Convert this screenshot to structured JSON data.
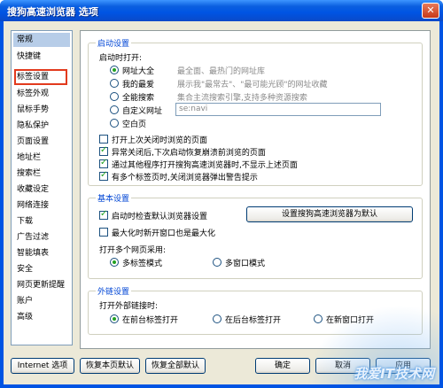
{
  "window": {
    "title": "搜狗高速浏览器 选项",
    "close_label": "✕"
  },
  "sidebar": {
    "items": [
      {
        "label": "常规"
      },
      {
        "label": "快捷键"
      },
      {
        "label": "标签设置"
      },
      {
        "label": "标签外观"
      },
      {
        "label": "鼠标手势"
      },
      {
        "label": "隐私保护"
      },
      {
        "label": "页面设置"
      },
      {
        "label": "地址栏"
      },
      {
        "label": "搜索栏"
      },
      {
        "label": "收藏设定"
      },
      {
        "label": "网络连接"
      },
      {
        "label": "下载"
      },
      {
        "label": "广告过滤"
      },
      {
        "label": "智能填表"
      },
      {
        "label": "安全"
      },
      {
        "label": "网页更新提醒"
      },
      {
        "label": "账户"
      },
      {
        "label": "高级"
      }
    ]
  },
  "startup": {
    "group_title": "启动设置",
    "open_label": "启动时打开:",
    "options": [
      {
        "label": "网址大全",
        "desc": "最全面、最热门的网址库",
        "checked": true
      },
      {
        "label": "我的最爱",
        "desc": "展示我\"最常去\"、\"最可能光顾\"的网址收藏",
        "checked": false
      },
      {
        "label": "全能搜索",
        "desc": "集合主流搜索引擎,支持多种资源搜索",
        "checked": false
      },
      {
        "label": "自定义网址",
        "desc": "",
        "checked": false
      },
      {
        "label": "空白页",
        "desc": "",
        "checked": false
      }
    ],
    "custom_url_value": "se:navi",
    "checkboxes": [
      {
        "label": "打开上次关闭时浏览的页面",
        "checked": false
      },
      {
        "label": "异常关闭后,下次启动恢复崩溃前浏览的页面",
        "checked": true
      },
      {
        "label": "通过其他程序打开搜狗高速浏览器时,不显示上述页面",
        "checked": true
      },
      {
        "label": "有多个标签页时,关闭浏览器弹出警告提示",
        "checked": true
      }
    ]
  },
  "basic": {
    "group_title": "基本设置",
    "check_default_label": "启动时检查默认浏览器设置",
    "check_default_checked": true,
    "set_default_button": "设置搜狗高速浏览器为默认",
    "maximize_label": "最大化时新开窗口也是最大化",
    "maximize_checked": false,
    "multi_open_label": "打开多个网页采用:",
    "multi_tab_label": "多标签模式",
    "multi_window_label": "多窗口模式"
  },
  "external": {
    "group_title": "外链设置",
    "open_label": "打开外部链接时:",
    "front_tab_label": "在前台标签打开",
    "back_tab_label": "在后台标签打开",
    "new_window_label": "在新窗口打开"
  },
  "footer": {
    "internet_options": "Internet 选项",
    "restore_page_default": "恢复本页默认",
    "restore_all_default": "恢复全部默认",
    "ok": "确定",
    "cancel": "取消",
    "apply": "应用"
  },
  "watermark": "我爱IT技术网"
}
